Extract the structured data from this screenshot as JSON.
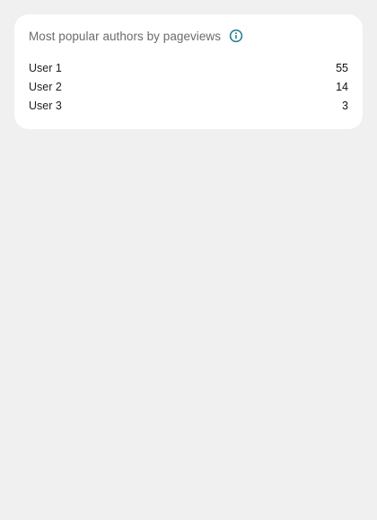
{
  "card": {
    "title": "Most popular authors by pageviews",
    "info_icon": "info-icon",
    "accent_color": "#1a7a8a"
  },
  "authors": [
    {
      "name": "User 1",
      "pageviews": "55"
    },
    {
      "name": "User 2",
      "pageviews": "14"
    },
    {
      "name": "User 3",
      "pageviews": "3"
    }
  ]
}
